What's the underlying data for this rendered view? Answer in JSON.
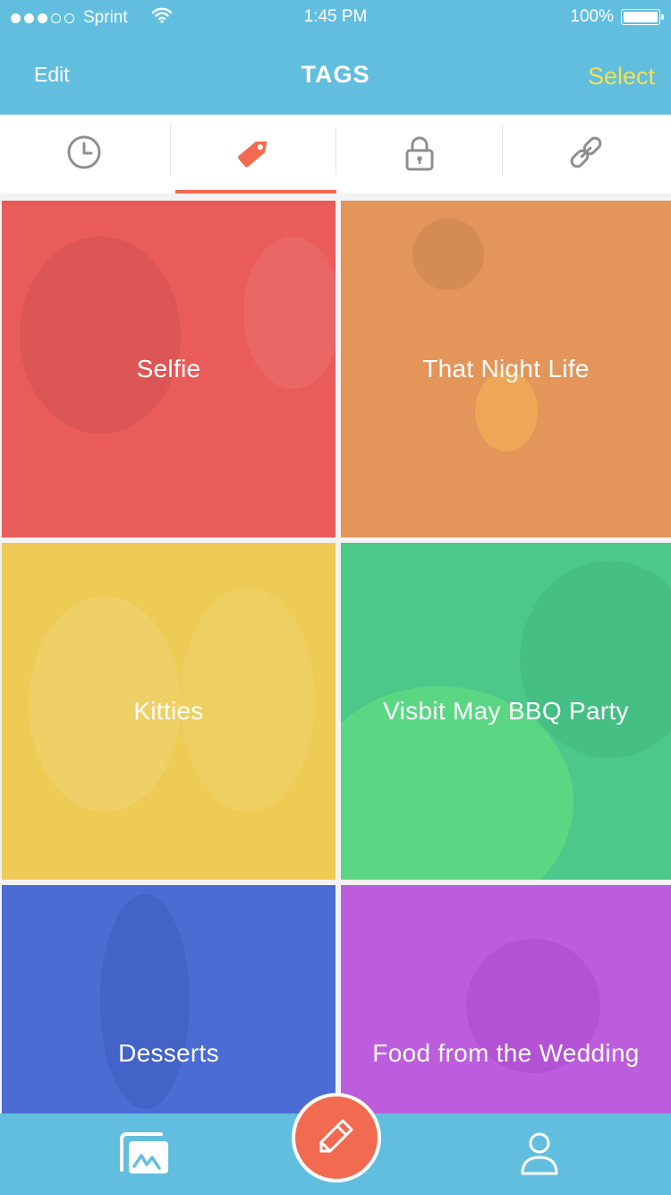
{
  "status": {
    "carrier": "Sprint",
    "time": "1:45 PM",
    "battery": "100%"
  },
  "nav": {
    "edit": "Edit",
    "title": "TAGS",
    "select": "Select"
  },
  "colors": {
    "accent": "#62bedf",
    "highlight": "#f26b50",
    "select": "#f6e04f"
  },
  "tabs": [
    {
      "icon": "clock-icon",
      "active": false
    },
    {
      "icon": "tag-icon",
      "active": true
    },
    {
      "icon": "lock-icon",
      "active": false
    },
    {
      "icon": "link-icon",
      "active": false
    }
  ],
  "tiles": [
    {
      "label": "Selfie",
      "color": "#e95c5a"
    },
    {
      "label": "That Night Life",
      "color": "#e3955a"
    },
    {
      "label": "Kitties",
      "color": "#edcb55"
    },
    {
      "label": "Visbit May BBQ Party",
      "color": "#4cc98a"
    },
    {
      "label": "Desserts",
      "color": "#4a6cd3"
    },
    {
      "label": "Food from the Wedding",
      "color": "#bb5ddd"
    }
  ],
  "bottom_nav": {
    "left_icon": "gallery-icon",
    "center_icon": "pencil-icon",
    "right_icon": "profile-icon"
  }
}
